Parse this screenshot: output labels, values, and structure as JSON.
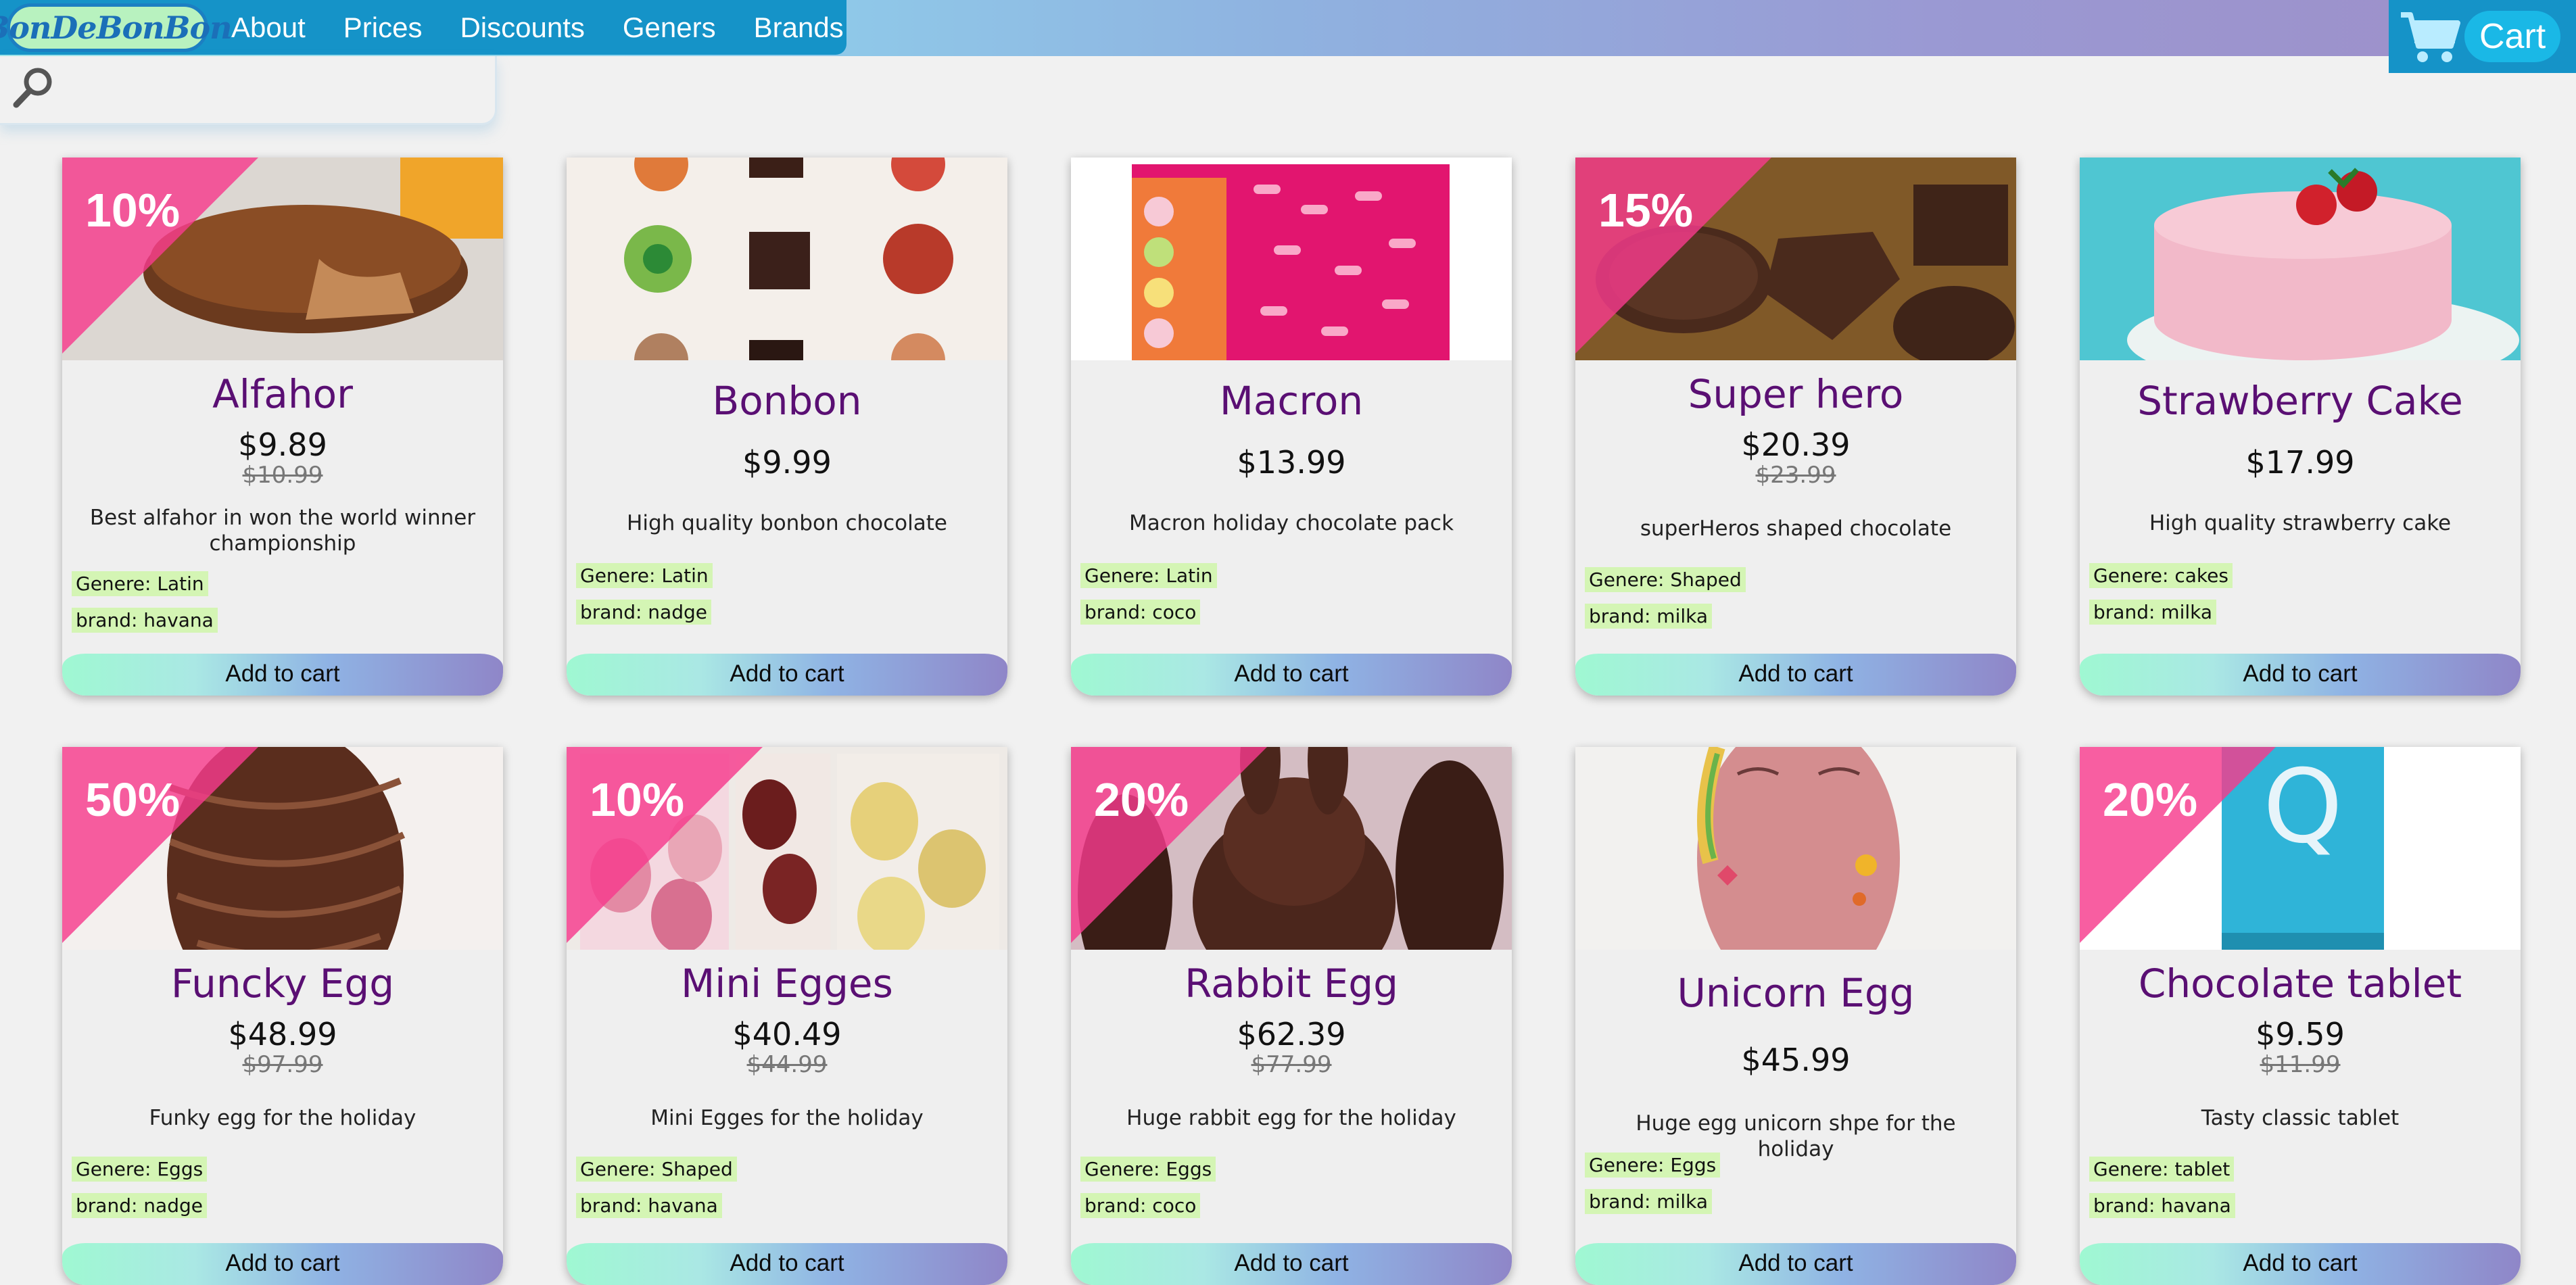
{
  "header": {
    "logo": "BonDeBonBon",
    "nav": [
      "About",
      "Prices",
      "Discounts",
      "Geners",
      "Brands"
    ],
    "cart_label": "Cart"
  },
  "search": {
    "placeholder": "",
    "value": ""
  },
  "products": [
    {
      "name": "Alfahor",
      "price": "$9.89",
      "old_price": "$10.99",
      "discount": "10%",
      "description": "Best alfahor in won the world winner championship",
      "genere": "Genere: Latin",
      "brand": "brand: havana",
      "button": "Add to cart",
      "image": "alfahor"
    },
    {
      "name": "Bonbon",
      "price": "$9.99",
      "old_price": "",
      "discount": "",
      "description": "High quality bonbon chocolate",
      "genere": "Genere: Latin",
      "brand": "brand: nadge",
      "button": "Add to cart",
      "image": "bonbons"
    },
    {
      "name": "Macron",
      "price": "$13.99",
      "old_price": "",
      "discount": "",
      "description": "Macron holiday chocolate pack",
      "genere": "Genere: Latin",
      "brand": "brand: coco",
      "button": "Add to cart",
      "image": "macaron-box"
    },
    {
      "name": "Super hero",
      "price": "$20.39",
      "old_price": "$23.99",
      "discount": "15%",
      "description": "superHeros shaped chocolate",
      "genere": "Genere: Shaped",
      "brand": "brand: milka",
      "button": "Add to cart",
      "image": "superhero-chocolate"
    },
    {
      "name": "Strawberry Cake",
      "price": "$17.99",
      "old_price": "",
      "discount": "",
      "description": "High quality strawberry cake",
      "genere": "Genere: cakes",
      "brand": "brand: milka",
      "button": "Add to cart",
      "image": "strawberry-cake"
    },
    {
      "name": "Funcky Egg",
      "price": "$48.99",
      "old_price": "$97.99",
      "discount": "50%",
      "description": "Funky egg for the holiday",
      "genere": "Genere: Eggs",
      "brand": "brand: nadge",
      "button": "Add to cart",
      "image": "funky-egg"
    },
    {
      "name": "Mini Egges",
      "price": "$40.49",
      "old_price": "$44.99",
      "discount": "10%",
      "description": "Mini Egges for the holiday",
      "genere": "Genere: Shaped",
      "brand": "brand: havana",
      "button": "Add to cart",
      "image": "mini-eggs"
    },
    {
      "name": "Rabbit Egg",
      "price": "$62.39",
      "old_price": "$77.99",
      "discount": "20%",
      "description": "Huge rabbit egg for the holiday",
      "genere": "Genere: Eggs",
      "brand": "brand: coco",
      "button": "Add to cart",
      "image": "rabbit"
    },
    {
      "name": "Unicorn Egg",
      "price": "$45.99",
      "old_price": "",
      "discount": "",
      "description": "Huge egg unicorn shpe for the holiday",
      "genere": "Genere: Eggs",
      "brand": "brand: milka",
      "button": "Add to cart",
      "image": "unicorn-egg"
    },
    {
      "name": "Chocolate tablet",
      "price": "$9.59",
      "old_price": "$11.99",
      "discount": "20%",
      "description": "Tasty classic tablet",
      "genere": "Genere: tablet",
      "brand": "brand: havana",
      "button": "Add to cart",
      "image": "chocolate-tablet"
    }
  ],
  "colors": {
    "nav_bg": "#1593c8",
    "title": "#5a0f73",
    "ribbon": "#f73a8c",
    "tag_bg": "#d4f5b4"
  }
}
